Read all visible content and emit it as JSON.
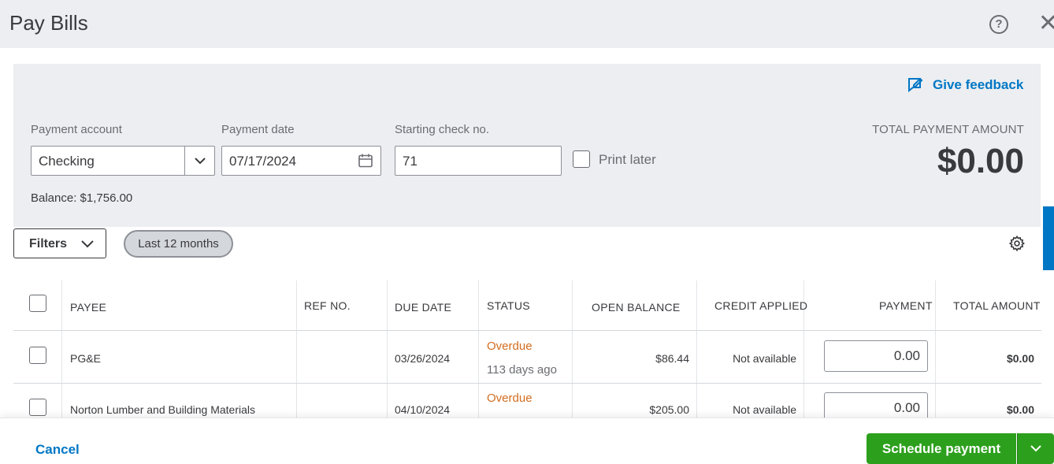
{
  "title": "Pay Bills",
  "feedback_label": "Give feedback",
  "payment_account": {
    "label": "Payment account",
    "value": "Checking"
  },
  "payment_date": {
    "label": "Payment date",
    "value": "07/17/2024"
  },
  "check_no": {
    "label": "Starting check no.",
    "value": "71"
  },
  "print_later": "Print later",
  "balance": "Balance: $1,756.00",
  "total": {
    "label": "TOTAL PAYMENT AMOUNT",
    "value": "$0.00"
  },
  "filters_label": "Filters",
  "chip_label": "Last 12 months",
  "columns": [
    "PAYEE",
    "REF NO.",
    "DUE DATE",
    "STATUS",
    "OPEN BALANCE",
    "CREDIT APPLIED",
    "PAYMENT",
    "TOTAL AMOUNT"
  ],
  "rows": [
    {
      "payee": "PG&E",
      "ref": "",
      "due": "03/26/2024",
      "status": "Overdue",
      "status_sub": "113 days ago",
      "open_balance": "$86.44",
      "credit": "Not available",
      "payment": "0.00",
      "total": "$0.00"
    },
    {
      "payee": "Norton Lumber and Building Materials",
      "ref": "",
      "due": "04/10/2024",
      "status": "Overdue",
      "status_sub": "",
      "open_balance": "$205.00",
      "credit": "Not available",
      "payment": "0.00",
      "total": "$0.00"
    }
  ],
  "footer": {
    "cancel": "Cancel",
    "schedule": "Schedule payment"
  },
  "colors": {
    "primary_blue": "#0077c5",
    "green": "#2ca01c",
    "overdue": "#d36d1f"
  }
}
